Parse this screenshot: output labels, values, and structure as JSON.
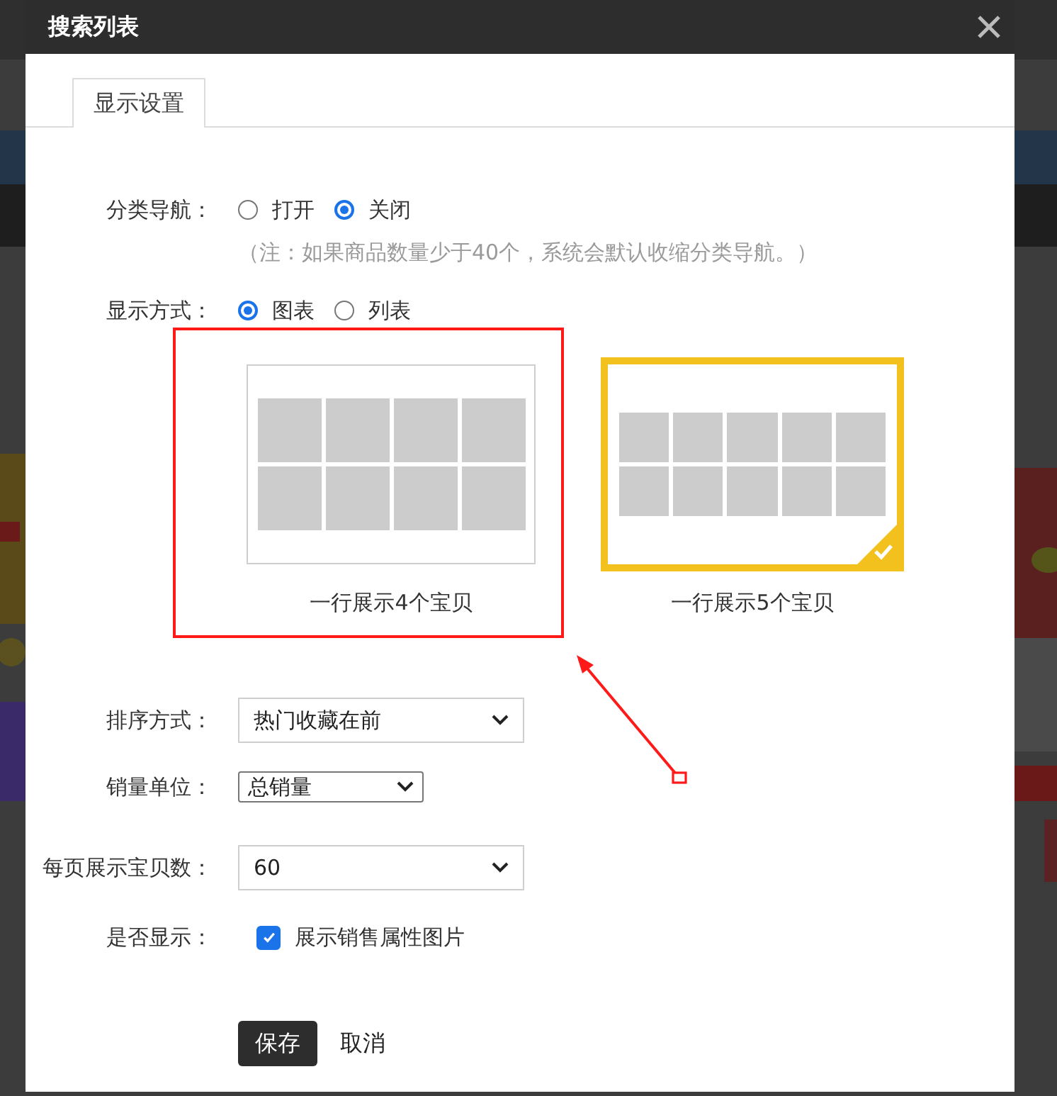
{
  "dialog": {
    "title": "搜索列表"
  },
  "tabs": [
    {
      "label": "显示设置",
      "selected": true
    }
  ],
  "category_nav": {
    "label": "分类导航：",
    "options": [
      {
        "label": "打开",
        "selected": false
      },
      {
        "label": "关闭",
        "selected": true
      }
    ],
    "note": "（注：如果商品数量少于40个，系统会默认收缩分类导航。）"
  },
  "display_mode": {
    "label": "显示方式：",
    "options": [
      {
        "label": "图表",
        "selected": true
      },
      {
        "label": "列表",
        "selected": false
      }
    ]
  },
  "layouts": [
    {
      "caption": "一行展示4个宝贝",
      "kind": "four",
      "selected": false
    },
    {
      "caption": "一行展示5个宝贝",
      "kind": "five",
      "selected": true
    }
  ],
  "fields": [
    {
      "label": "排序方式：",
      "value": "热门收藏在前",
      "kind": "wide"
    },
    {
      "label": "销量单位：",
      "value": "总销量",
      "kind": "compact"
    },
    {
      "label": "每页展示宝贝数：",
      "value": "60",
      "kind": "wide"
    }
  ],
  "show": {
    "label": "是否显示：",
    "option": {
      "label": "展示销售属性图片",
      "checked": true
    }
  },
  "buttons": [
    {
      "label": "保存",
      "kind": "primary"
    },
    {
      "label": "取消",
      "kind": "plain"
    }
  ],
  "annotation": {
    "kind": "highlight-with-arrow"
  }
}
